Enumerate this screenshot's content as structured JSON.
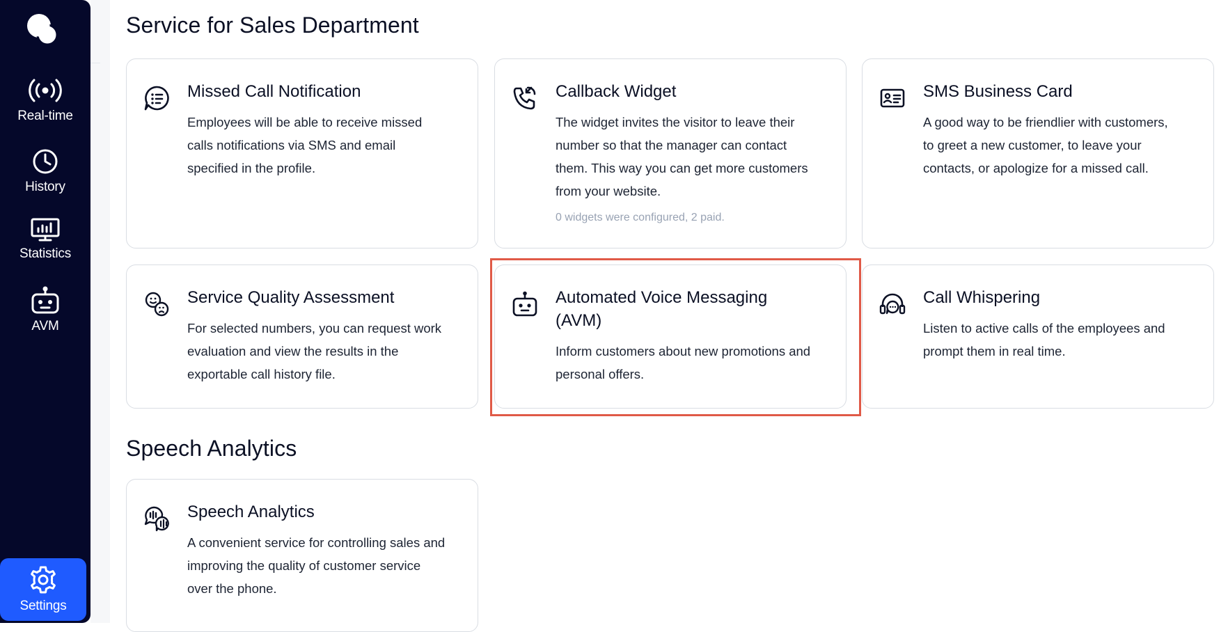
{
  "sidebar": {
    "items": [
      {
        "label": "Real-time",
        "icon": "broadcast-icon"
      },
      {
        "label": "History",
        "icon": "clock-icon"
      },
      {
        "label": "Statistics",
        "icon": "chart-monitor-icon"
      },
      {
        "label": "AVM",
        "icon": "robot-icon"
      }
    ],
    "settings_label": "Settings",
    "active": "Settings",
    "active_color": "#1f5bff"
  },
  "sections": {
    "sales_title": "Service for Sales Department",
    "speech_title": "Speech Analytics"
  },
  "cards": {
    "missed_call": {
      "title": "Missed Call Notification",
      "desc1": "Employees will be able to receive missed",
      "desc2": "calls notifications via SMS and email",
      "desc3": "specified in the profile."
    },
    "callback": {
      "title": "Callback Widget",
      "desc1": "The widget invites the visitor to leave their",
      "desc2": "number so that the manager can contact",
      "desc3": "them. This way you can get more customers",
      "desc4": "from your website.",
      "note": "0 widgets were configured, 2 paid."
    },
    "sms_card": {
      "title": "SMS Business Card",
      "desc1": "A good way to be friendlier with customers,",
      "desc2": "to greet a new customer, to leave your",
      "desc3": "contacts, or apologize for a missed call."
    },
    "quality": {
      "title": "Service Quality Assessment",
      "desc1": "For selected numbers, you can request work",
      "desc2": "evaluation and view the results in the",
      "desc3": "exportable call history file."
    },
    "avm": {
      "title1": "Automated Voice Messaging",
      "title2": "(AVM)",
      "desc1": "Inform customers about new promotions and",
      "desc2": "personal offers."
    },
    "whisper": {
      "title": "Call Whispering",
      "desc1": "Listen to active calls of the employees and",
      "desc2": "prompt them in real time."
    },
    "speech": {
      "title": "Speech Analytics",
      "desc1": "A convenient service for controlling sales and",
      "desc2": "improving the quality of customer service",
      "desc3": "over the phone."
    }
  },
  "highlight_color": "#e05a47"
}
